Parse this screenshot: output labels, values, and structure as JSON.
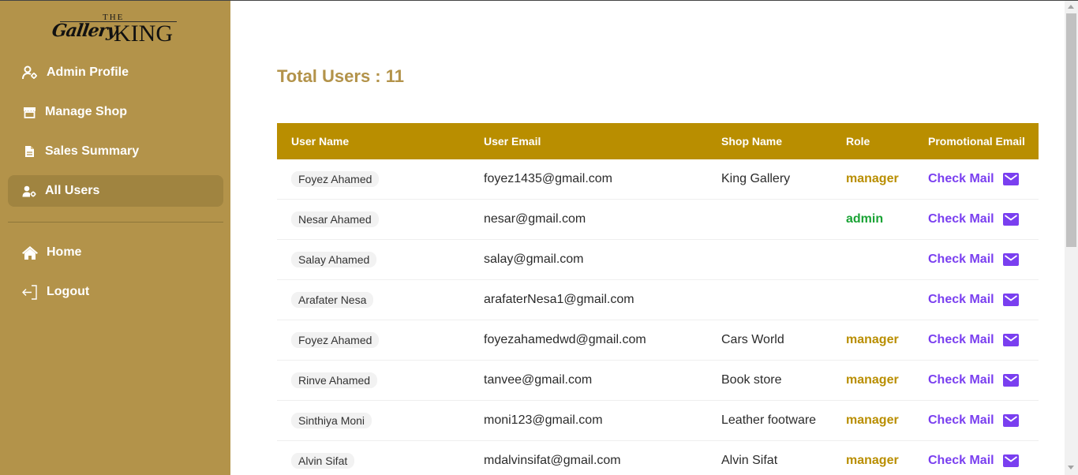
{
  "logo": {
    "the": "THE",
    "gallery": "Gallery",
    "king": "KING"
  },
  "sidebar": {
    "items": [
      {
        "label": "Admin Profile",
        "icon": "user-gear-icon"
      },
      {
        "label": "Manage Shop",
        "icon": "store-icon"
      },
      {
        "label": "Sales Summary",
        "icon": "file-icon"
      },
      {
        "label": "All Users",
        "icon": "users-gear-icon",
        "active": true
      }
    ],
    "bottom_items": [
      {
        "label": "Home",
        "icon": "home-icon"
      },
      {
        "label": "Logout",
        "icon": "logout-icon"
      }
    ]
  },
  "main": {
    "total_users": "Total Users : 11",
    "table": {
      "headers": [
        "User Name",
        "User Email",
        "Shop Name",
        "Role",
        "Promotional Email"
      ],
      "rows": [
        {
          "name": "Foyez Ahamed",
          "email": "foyez1435@gmail.com",
          "shop": "King Gallery",
          "role": "manager",
          "mail": "Check Mail"
        },
        {
          "name": "Nesar Ahamed",
          "email": "nesar@gmail.com",
          "shop": "",
          "role": "admin",
          "mail": "Check Mail"
        },
        {
          "name": "Salay Ahamed",
          "email": "salay@gmail.com",
          "shop": "",
          "role": "",
          "mail": "Check Mail"
        },
        {
          "name": "Arafater Nesa",
          "email": "arafaterNesa1@gmail.com",
          "shop": "",
          "role": "",
          "mail": "Check Mail"
        },
        {
          "name": "Foyez Ahamed",
          "email": "foyezahamedwd@gmail.com",
          "shop": "Cars World",
          "role": "manager",
          "mail": "Check Mail"
        },
        {
          "name": "Rinve Ahamed",
          "email": "tanvee@gmail.com",
          "shop": "Book store",
          "role": "manager",
          "mail": "Check Mail"
        },
        {
          "name": "Sinthiya Moni",
          "email": "moni123@gmail.com",
          "shop": "Leather footware",
          "role": "manager",
          "mail": "Check Mail"
        },
        {
          "name": "Alvin Sifat",
          "email": "mdalvinsifat@gmail.com",
          "shop": "Alvin Sifat",
          "role": "manager",
          "mail": "Check Mail"
        }
      ]
    }
  },
  "colors": {
    "sidebar_bg": "#b3934a",
    "header_bg": "#b98e00",
    "manager": "#b98e00",
    "admin": "#1aa335",
    "mail": "#7a3ff0"
  }
}
